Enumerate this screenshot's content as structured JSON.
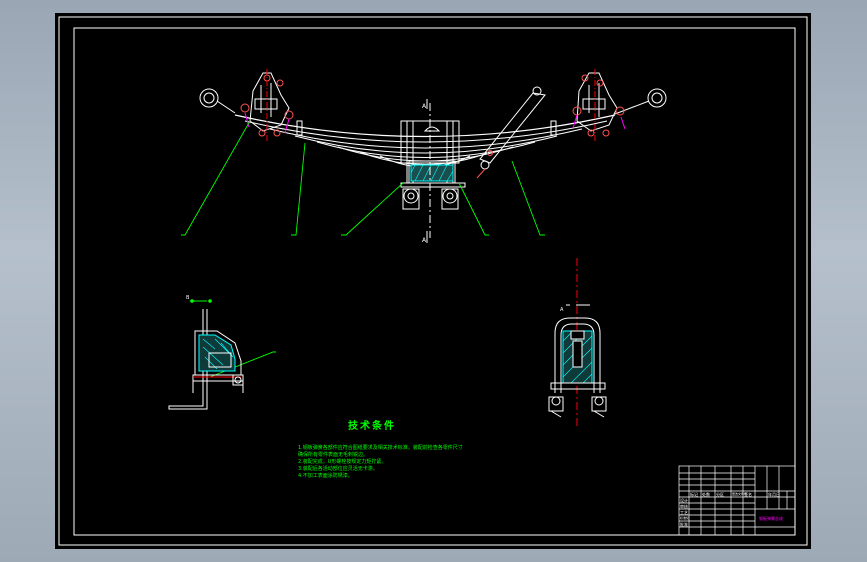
{
  "drawing": {
    "background": "#000000",
    "line_color": "#ffffff",
    "leader_color": "#00ff00",
    "centerline_color": "#ff0000",
    "hatch_color": "#00ffff",
    "part_color": "#ff00ff"
  },
  "section_marks": {
    "main_view": [
      "A",
      "A"
    ],
    "left_view": [
      "B",
      "B"
    ],
    "right_view": [
      "A",
      "A"
    ]
  },
  "technical_requirements": {
    "title": "技术条件",
    "notes": [
      "1.钢板弹簧各部件应符合图纸要求及相关技术标准，装配前检查各零件尺寸",
      "  确保所有零件表面无毛刺锐边。",
      "2.装配完成，U形螺栓按规定力矩拧紧。",
      "3.装配后各活动部位应灵活无卡滞。",
      "4.不加工表面涂防锈漆。"
    ]
  },
  "title_block": {
    "drawing_name": "钢板弹簧总成",
    "header_cells": [
      "标记",
      "处数",
      "分区",
      "更改文件号",
      "签名",
      "年月日"
    ],
    "role_cells": [
      "设计",
      "审核",
      "工艺",
      "标准化",
      "批准"
    ]
  }
}
